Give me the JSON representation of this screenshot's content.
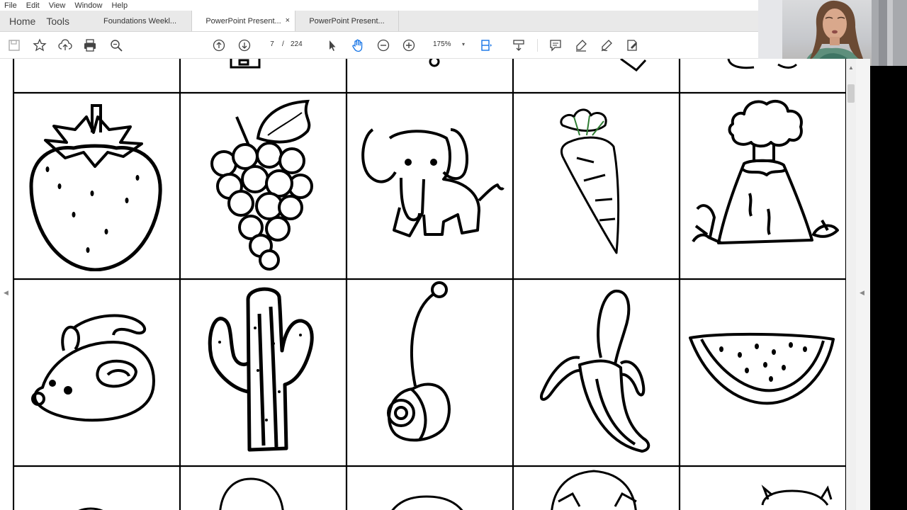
{
  "menu": [
    "File",
    "Edit",
    "View",
    "Window",
    "Help"
  ],
  "nav": {
    "home": "Home",
    "tools": "Tools"
  },
  "tabs": [
    {
      "label": "Foundations Weekl...",
      "active": false
    },
    {
      "label": "PowerPoint Present...",
      "active": true,
      "close": "×"
    },
    {
      "label": "PowerPoint Present...",
      "active": false
    }
  ],
  "toolbar": {
    "page_current": "7",
    "page_separator": "/",
    "page_total": "224",
    "zoom": "175%",
    "zoom_caret": "▾",
    "icons": [
      "save-icon",
      "bookmark-star-icon",
      "upload-cloud-icon",
      "print-icon",
      "find-zoom-icon",
      "previous-page-icon",
      "next-page-icon",
      "select-arrow-icon",
      "hand-tool-icon",
      "zoom-out-icon",
      "zoom-in-icon",
      "fit-page-icon",
      "scroll-mode-icon",
      "comment-icon",
      "highlight-icon",
      "sign-icon",
      "fill-sign-icon"
    ]
  },
  "document": {
    "pictures": {
      "row1": [
        "strawberry",
        "grapes",
        "elephant",
        "carrot",
        "volcano"
      ],
      "row2": [
        "mouse",
        "cactus",
        "yo-yo",
        "banana",
        "watermelon"
      ]
    }
  },
  "colors": {
    "accent": "#1473e6",
    "tab_bg": "#e9e9e9",
    "active_tab": "#ffffff",
    "ink": "#000000"
  },
  "scroll": {
    "up": "▲",
    "left": "◀",
    "right": "◀"
  }
}
